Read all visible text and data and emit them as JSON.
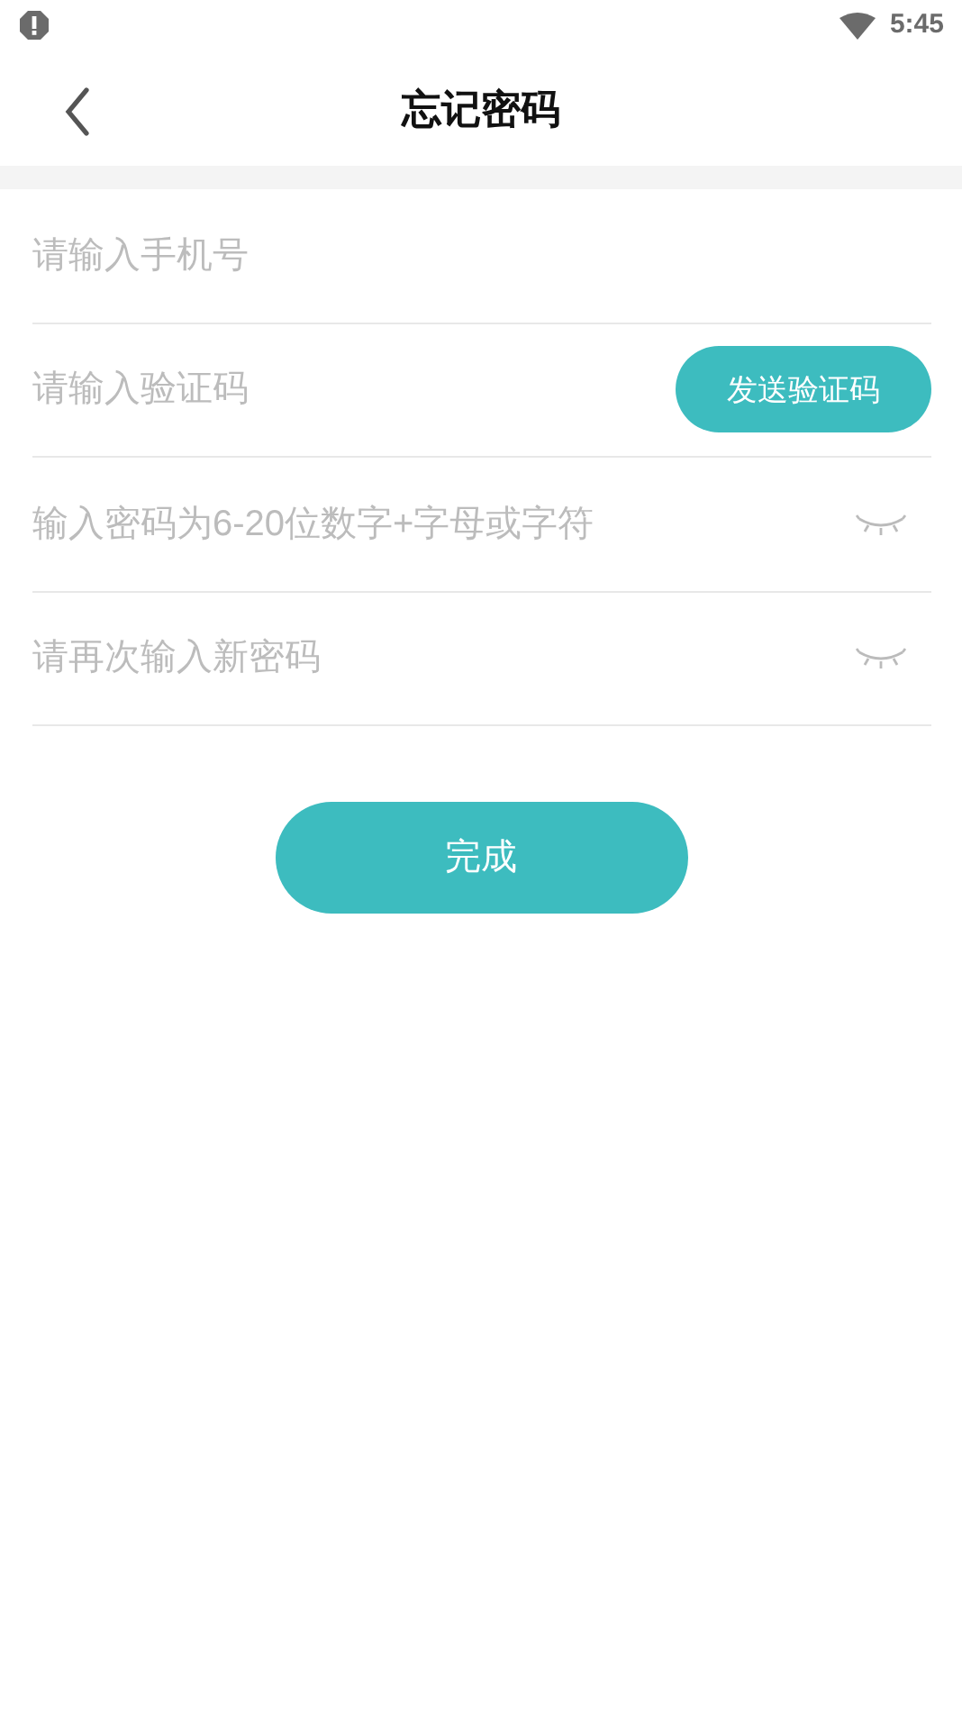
{
  "status_bar": {
    "time": "5:45"
  },
  "header": {
    "title": "忘记密码"
  },
  "fields": [
    {
      "kind": "text",
      "placeholder": "请输入手机号"
    },
    {
      "kind": "code",
      "placeholder": "请输入验证码",
      "button": "发送验证码"
    },
    {
      "kind": "password",
      "placeholder": "输入密码为6-20位数字+字母或字符",
      "visible": false
    },
    {
      "kind": "password",
      "placeholder": "请再次输入新密码",
      "visible": false
    }
  ],
  "submit": "完成"
}
